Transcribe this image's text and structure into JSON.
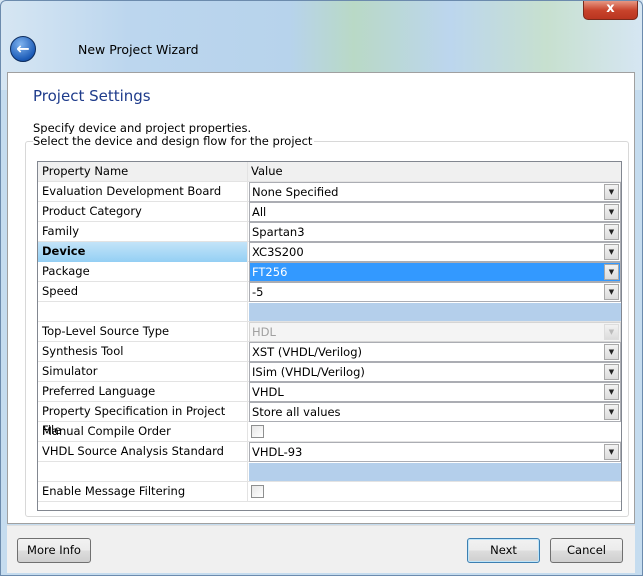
{
  "window": {
    "title": "New Project Wizard",
    "close_label": "x"
  },
  "page": {
    "heading": "Project Settings",
    "description": "Specify device and project properties.",
    "group_label": "Select the device and design flow for the project"
  },
  "table": {
    "headers": {
      "name": "Property Name",
      "value": "Value"
    },
    "rows": [
      {
        "name": "Evaluation Development Board",
        "type": "combo",
        "value": "None Specified"
      },
      {
        "name": "Product Category",
        "type": "combo",
        "value": "All"
      },
      {
        "name": "Family",
        "type": "combo",
        "value": "Spartan3"
      },
      {
        "name": "Device",
        "type": "combo",
        "value": "XC3S200",
        "highlight": true
      },
      {
        "name": "Package",
        "type": "combo",
        "value": "FT256",
        "selected": true
      },
      {
        "name": "Speed",
        "type": "combo",
        "value": "-5"
      },
      {
        "name": "",
        "type": "blank",
        "value": ""
      },
      {
        "name": "Top-Level Source Type",
        "type": "combo",
        "value": "HDL",
        "disabled": true
      },
      {
        "name": "Synthesis Tool",
        "type": "combo",
        "value": "XST (VHDL/Verilog)"
      },
      {
        "name": "Simulator",
        "type": "combo",
        "value": "ISim (VHDL/Verilog)"
      },
      {
        "name": "Preferred Language",
        "type": "combo",
        "value": "VHDL"
      },
      {
        "name": "Property Specification in Project File",
        "type": "combo",
        "value": "Store all values"
      },
      {
        "name": "Manual Compile Order",
        "type": "check",
        "checked": false
      },
      {
        "name": "VHDL Source Analysis Standard",
        "type": "combo",
        "value": "VHDL-93"
      },
      {
        "name": "",
        "type": "blank",
        "value": ""
      },
      {
        "name": "Enable Message Filtering",
        "type": "check",
        "checked": false
      }
    ]
  },
  "buttons": {
    "more_info": "More Info",
    "next": "Next",
    "cancel": "Cancel"
  }
}
